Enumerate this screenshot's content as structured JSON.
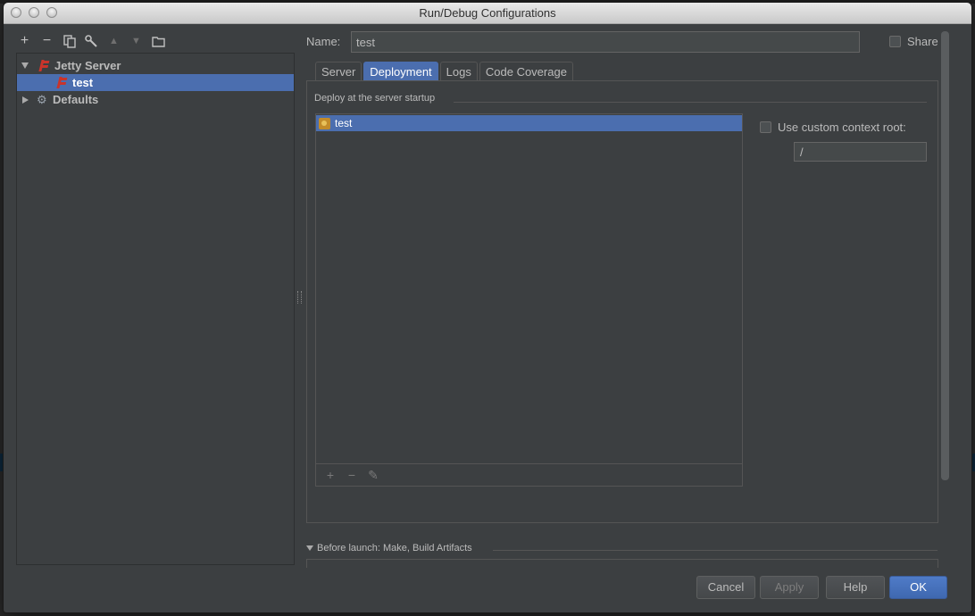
{
  "window": {
    "title": "Run/Debug Configurations"
  },
  "toolbar": {
    "add": "+",
    "remove": "−",
    "up": "▲",
    "down": "▼"
  },
  "tree": {
    "items": [
      {
        "label": "Jetty Server",
        "icon": "jetty-icon",
        "expanded": true
      },
      {
        "label": "test",
        "icon": "jetty-icon",
        "selected": true
      },
      {
        "label": "Defaults",
        "icon": "wrench-icon",
        "expanded": false
      }
    ]
  },
  "config": {
    "name_label": "Name:",
    "name_value": "test",
    "share_label": "Share"
  },
  "tabs": [
    {
      "label": "Server",
      "active": false
    },
    {
      "label": "Deployment",
      "active": true
    },
    {
      "label": "Logs",
      "active": false
    },
    {
      "label": "Code Coverage",
      "active": false
    }
  ],
  "deployment": {
    "section_title": "Deploy at the server startup",
    "artifacts": [
      {
        "label": "test",
        "selected": true
      }
    ],
    "list_toolbar": {
      "add": "+",
      "remove": "−",
      "edit": "✎"
    },
    "context_root_label": "Use custom context root:",
    "context_root_value": "/"
  },
  "before_launch": {
    "label": "Before launch: Make, Build Artifacts"
  },
  "buttons": {
    "cancel": "Cancel",
    "apply": "Apply",
    "help": "Help",
    "ok": "OK"
  },
  "colors": {
    "selection": "#4b6eaf",
    "panel": "#3c3f41",
    "text": "#bbbbbb"
  }
}
